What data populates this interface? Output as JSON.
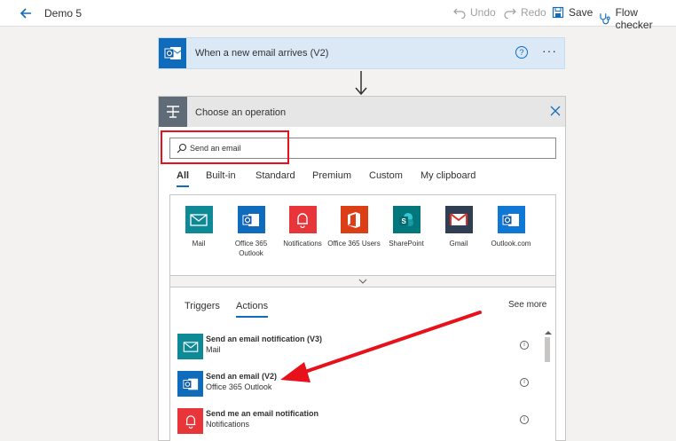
{
  "topbar": {
    "title": "Demo 5",
    "undo": "Undo",
    "redo": "Redo",
    "save": "Save",
    "flow_checker": "Flow checker"
  },
  "trigger": {
    "label": "When a new email arrives (V2)",
    "help": "?",
    "more": "···"
  },
  "panel": {
    "title": "Choose an operation",
    "search": {
      "value": "Send an email",
      "placeholder": ""
    },
    "tabs": [
      "All",
      "Built-in",
      "Standard",
      "Premium",
      "Custom",
      "My clipboard"
    ],
    "active_tab": "All",
    "connectors": [
      {
        "name": "Mail",
        "icon": "mail-icon",
        "color": "#0d8a96"
      },
      {
        "name": "Office 365 Outlook",
        "icon": "outlook-icon",
        "color": "#0f6cbd"
      },
      {
        "name": "Notifications",
        "icon": "bell-icon",
        "color": "#e8353a"
      },
      {
        "name": "Office 365 Users",
        "icon": "office-icon",
        "color": "#dc3e15"
      },
      {
        "name": "SharePoint",
        "icon": "sharepoint-icon",
        "color": "#03787c"
      },
      {
        "name": "Gmail",
        "icon": "gmail-icon",
        "color": "#2f3e53"
      },
      {
        "name": "Outlook.com",
        "icon": "outlook-icon",
        "color": "#0f78d4"
      }
    ],
    "subtabs": [
      "Triggers",
      "Actions"
    ],
    "active_subtab": "Actions",
    "see_more": "See more",
    "actions": [
      {
        "title": "Send an email notification (V3)",
        "subtitle": "Mail",
        "icon": "mail-icon",
        "color": "#0d8a96"
      },
      {
        "title": "Send an email (V2)",
        "subtitle": "Office 365 Outlook",
        "icon": "outlook-icon",
        "color": "#0f6cbd"
      },
      {
        "title": "Send me an email notification",
        "subtitle": "Notifications",
        "icon": "bell-icon",
        "color": "#e8353a"
      }
    ],
    "info_glyph": "i"
  }
}
